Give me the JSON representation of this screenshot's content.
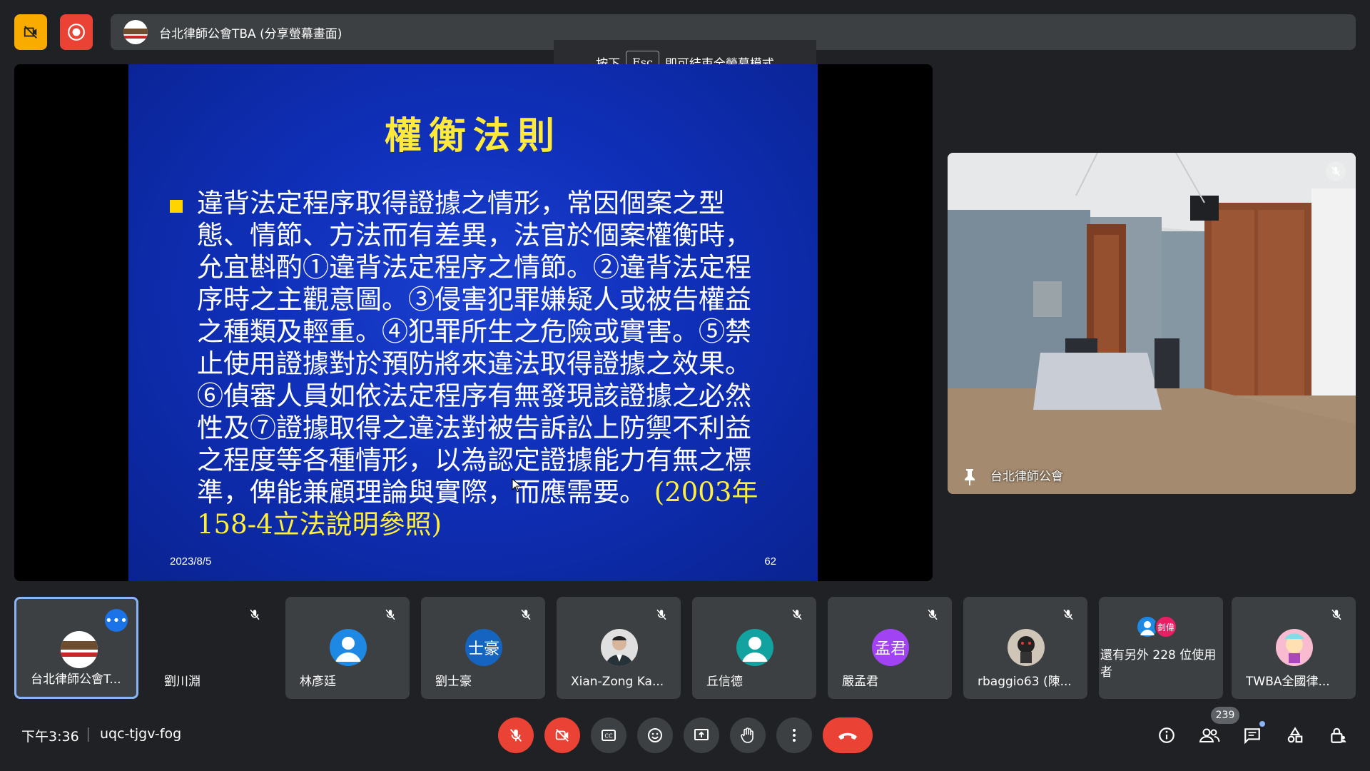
{
  "top": {
    "presenter_title": "台北律師公會TBA (分享螢幕畫面)",
    "esc_prefix": "按下",
    "esc_key": "Esc",
    "esc_suffix": "即可結束全螢幕模式"
  },
  "slide": {
    "title": "權衡法則",
    "body": "違背法定程序取得證據之情形，常因個案之型態、情節、方法而有差異，法官於個案權衡時，允宜斟酌①違背法定程序之情節。②違背法定程序時之主觀意圖。③侵害犯罪嫌疑人或被告權益之種類及輕重。④犯罪所生之危險或實害。⑤禁止使用證據對於預防將來違法取得證據之效果。⑥偵審人員如依法定程序有無發現該證據之必然性及⑦證據取得之違法對被告訴訟上防禦不利益之程度等各種情形，以為認定證據能力有無之標準，俾能兼顧理論與實際，而應需要。",
    "citation": "(2003年158-4立法說明參照)",
    "date": "2023/8/5",
    "page": "62"
  },
  "room": {
    "label": "台北律師公會"
  },
  "participants": [
    {
      "name": "台北律師公會T..."
    },
    {
      "name": "劉川淵"
    },
    {
      "name": "林彥廷"
    },
    {
      "name": "劉士豪",
      "initials": "士豪"
    },
    {
      "name": "Xian-Zong Ka..."
    },
    {
      "name": "丘信德"
    },
    {
      "name": "嚴孟君",
      "initials": "孟君"
    },
    {
      "name": "rbaggio63 (陳..."
    },
    {
      "name": "還有另外 228 位使用者",
      "initials": "釗偉"
    },
    {
      "name": "TWBA全國律..."
    }
  ],
  "bottom": {
    "time": "下午3:36",
    "meeting_code": "uqc-tjgv-fog",
    "people_count": "239"
  },
  "colors": {
    "accent": "#8ab4f8",
    "danger": "#ea4335",
    "slide_bg": "#0f2fb8",
    "slide_title": "#ffea3a"
  }
}
